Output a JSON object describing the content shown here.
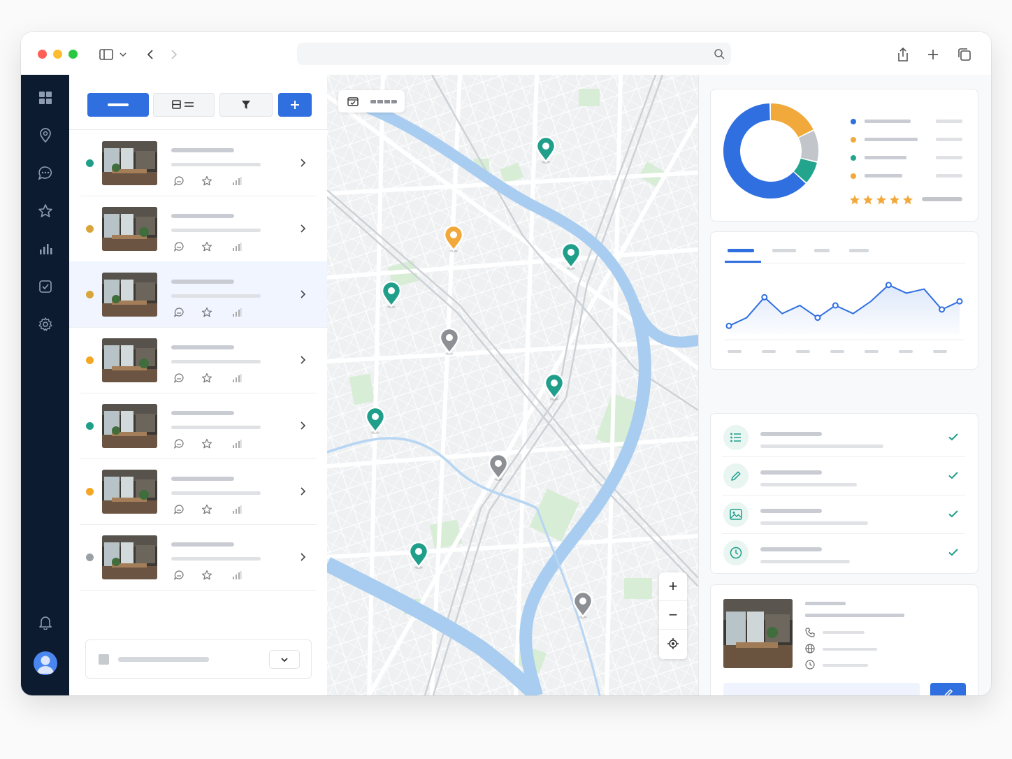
{
  "window": {
    "traffic_lights": [
      "#ff5f57",
      "#febc2e",
      "#28c840"
    ]
  },
  "titlebar": {
    "icons": [
      "sidebar-toggle-icon",
      "chevron-down-icon",
      "back-icon",
      "forward-icon",
      "search-icon",
      "share-icon",
      "new-tab-icon",
      "tabs-overview-icon"
    ],
    "address": ""
  },
  "nav": {
    "items": [
      "grid-icon",
      "location-pin-icon",
      "chat-icon",
      "star-icon",
      "bar-chart-icon",
      "checkbox-icon",
      "gear-icon"
    ],
    "bottom": [
      "bell-icon",
      "user-avatar"
    ],
    "background": "#0d1b31"
  },
  "list": {
    "toolbar": [
      "primary-action",
      "view-toggle",
      "filter",
      "add"
    ],
    "items": [
      {
        "status": "#1f9e8a"
      },
      {
        "status": "#d9a53a"
      },
      {
        "status": "#d9a53a",
        "selected": true
      },
      {
        "status": "#f5a623"
      },
      {
        "status": "#1f9e8a"
      },
      {
        "status": "#f5a623"
      },
      {
        "status": "#9aa0a6"
      }
    ]
  },
  "map": {
    "pins": [
      {
        "color": "#1f9e8a"
      },
      {
        "color": "#f2a93b"
      },
      {
        "color": "#1f9e8a"
      },
      {
        "color": "#1f9e8a"
      },
      {
        "color": "#8c8f94"
      },
      {
        "color": "#1f9e8a"
      },
      {
        "color": "#1f9e8a"
      },
      {
        "color": "#8c8f94"
      },
      {
        "color": "#1f9e8a"
      },
      {
        "color": "#8c8f94"
      }
    ],
    "zoom_in": "+",
    "zoom_out": "−"
  },
  "right": {
    "donut": {
      "segments": [
        {
          "value": 0.63,
          "color": "#2f6fe0"
        },
        {
          "value": 0.18,
          "color": "#f2a93b"
        },
        {
          "value": 0.11,
          "color": "#c2c5ca"
        },
        {
          "value": 0.08,
          "color": "#22a58c"
        }
      ],
      "legend_colors": [
        "#2f6fe0",
        "#f2a93b",
        "#22a58c",
        "#f2a93b"
      ],
      "rating": 5
    },
    "line_chart": {
      "type": "line",
      "values": [
        2,
        4,
        9,
        5,
        7,
        4,
        7,
        5,
        8,
        12,
        10,
        11,
        6,
        8
      ],
      "ylim": [
        0,
        14
      ]
    },
    "tasks": [
      {
        "icon": "list-icon",
        "done": true
      },
      {
        "icon": "pencil-icon",
        "done": true
      },
      {
        "icon": "image-icon",
        "done": true
      },
      {
        "icon": "clock-icon",
        "done": true
      }
    ],
    "contact": {
      "icons": [
        "phone-icon",
        "globe-icon",
        "clock-icon"
      ]
    },
    "accent": "#2f6fe0"
  }
}
